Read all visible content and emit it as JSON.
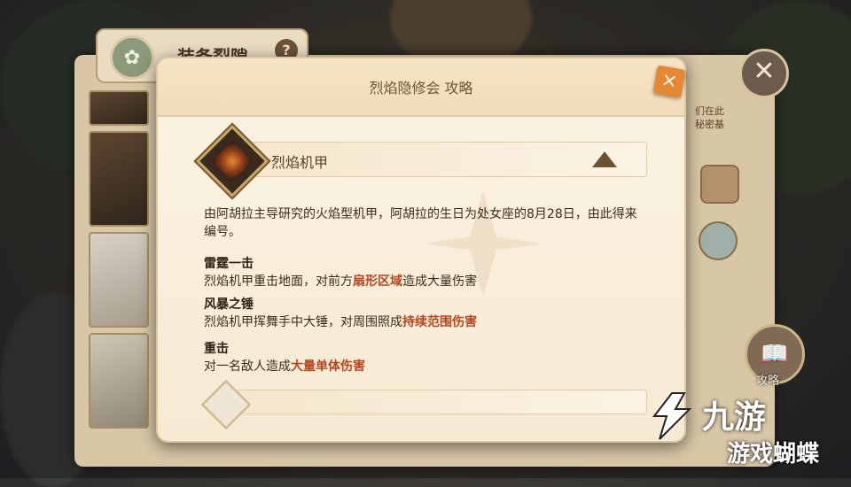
{
  "back_panel": {
    "title": "装备裂隙",
    "help_label": "?",
    "side_note": "们在此\n秘密基"
  },
  "dialog": {
    "title": "烈焰隐修会 攻略",
    "close_glyph": "×",
    "item": {
      "name": "烈焰机甲",
      "description": "由阿胡拉主导研究的火焰型机甲，阿胡拉的生日为处女座的8月28日，由此得来编号。"
    },
    "skills": [
      {
        "name": "雷霆一击",
        "text_prefix": "烈焰机甲重击地面，对前方",
        "highlight": "扇形区域",
        "text_suffix": "造成大量伤害"
      },
      {
        "name": "风暴之锤",
        "text_prefix": "烈焰机甲挥舞手中大锤，对周围照成",
        "highlight": "持续范围伤害",
        "text_suffix": ""
      },
      {
        "name": "重击",
        "text_prefix": "对一名敌人造成",
        "highlight": "大量单体伤害",
        "text_suffix": ""
      }
    ]
  },
  "controls": {
    "close_glyph": "✕",
    "guide_label": "攻略"
  },
  "watermark": {
    "line1": "九游",
    "line2": "游戏蝴蝶"
  },
  "colors": {
    "highlight": "#b8441c",
    "accent_orange": "#e48834"
  }
}
